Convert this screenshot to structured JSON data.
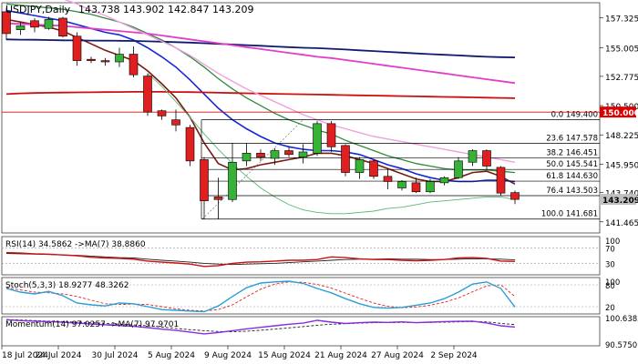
{
  "window": {
    "symbol_label": "USDJPY,Daily",
    "ohlc_label": "143.738 143.902 142.847 143.209"
  },
  "colors": {
    "background": "#ffffff",
    "bull": "#36b336",
    "bear": "#e02020",
    "ma_fast": "#7a1a10",
    "ma_blue": "#1428d8",
    "ma_green": "#2e8b3c",
    "ma_magenta": "#e040c8",
    "ma_red": "#cc1010",
    "ma_navy": "#101a6e",
    "ma_pink": "#f0a0e0",
    "bollinger": "#58b878",
    "fib_lines": "#000000",
    "last_price_box": "#c0c0c0",
    "level_150_box": "#dd0000",
    "rsi_line": "#cc1010",
    "rsi_ma": "#222222",
    "stoch_main": "#2a9fd6",
    "stoch_signal": "#dd2222",
    "momentum_main": "#8a2be2",
    "momentum_ma": "#222222"
  },
  "chart_data": {
    "type": "candlestick",
    "dates_axis": [
      "18 Jul 2024",
      "24 Jul 2024",
      "30 Jul 2024",
      "5 Aug 2024",
      "9 Aug 2024",
      "15 Aug 2024",
      "21 Aug 2024",
      "27 Aug 2024",
      "2 Sep 2024"
    ],
    "price_axis_ticks": [
      "157.325",
      "155.005",
      "152.775",
      "150.500",
      "148.225",
      "145.950",
      "143.740",
      "141.465"
    ],
    "y_range": [
      140.6,
      158.5
    ],
    "candles": [
      {
        "o": 157.8,
        "h": 158.1,
        "l": 155.6,
        "c": 156.1
      },
      {
        "o": 156.4,
        "h": 157.0,
        "l": 156.0,
        "c": 156.7
      },
      {
        "o": 157.1,
        "h": 157.3,
        "l": 156.2,
        "c": 156.6
      },
      {
        "o": 156.5,
        "h": 157.4,
        "l": 156.4,
        "c": 157.2
      },
      {
        "o": 157.3,
        "h": 157.4,
        "l": 155.8,
        "c": 155.9
      },
      {
        "o": 155.9,
        "h": 156.2,
        "l": 153.6,
        "c": 154.0
      },
      {
        "o": 154.1,
        "h": 154.3,
        "l": 153.8,
        "c": 154.0
      },
      {
        "o": 154.0,
        "h": 154.2,
        "l": 153.6,
        "c": 153.9
      },
      {
        "o": 153.9,
        "h": 155.0,
        "l": 153.5,
        "c": 154.5
      },
      {
        "o": 154.5,
        "h": 155.1,
        "l": 152.7,
        "c": 152.9
      },
      {
        "o": 152.8,
        "h": 153.0,
        "l": 149.7,
        "c": 150.0
      },
      {
        "o": 150.1,
        "h": 150.2,
        "l": 149.4,
        "c": 149.7
      },
      {
        "o": 149.4,
        "h": 150.2,
        "l": 148.5,
        "c": 149.0
      },
      {
        "o": 148.8,
        "h": 149.0,
        "l": 145.8,
        "c": 146.2
      },
      {
        "o": 146.3,
        "h": 146.5,
        "l": 141.7,
        "c": 143.1
      },
      {
        "o": 143.4,
        "h": 144.9,
        "l": 141.7,
        "c": 143.2
      },
      {
        "o": 143.2,
        "h": 147.6,
        "l": 143.0,
        "c": 146.1
      },
      {
        "o": 146.2,
        "h": 147.6,
        "l": 145.8,
        "c": 146.8
      },
      {
        "o": 146.8,
        "h": 147.1,
        "l": 146.2,
        "c": 146.5
      },
      {
        "o": 146.4,
        "h": 147.2,
        "l": 145.9,
        "c": 147.0
      },
      {
        "o": 147.0,
        "h": 147.3,
        "l": 146.5,
        "c": 146.7
      },
      {
        "o": 146.5,
        "h": 147.5,
        "l": 146.0,
        "c": 146.9
      },
      {
        "o": 146.8,
        "h": 149.3,
        "l": 146.6,
        "c": 149.1
      },
      {
        "o": 149.1,
        "h": 149.3,
        "l": 146.9,
        "c": 147.3
      },
      {
        "o": 147.4,
        "h": 147.5,
        "l": 145.0,
        "c": 145.3
      },
      {
        "o": 145.3,
        "h": 146.5,
        "l": 144.8,
        "c": 146.3
      },
      {
        "o": 146.2,
        "h": 146.3,
        "l": 144.8,
        "c": 145.0
      },
      {
        "o": 145.0,
        "h": 145.6,
        "l": 144.0,
        "c": 144.6
      },
      {
        "o": 144.1,
        "h": 144.7,
        "l": 143.9,
        "c": 144.6
      },
      {
        "o": 144.5,
        "h": 144.9,
        "l": 143.7,
        "c": 143.8
      },
      {
        "o": 143.8,
        "h": 144.8,
        "l": 143.7,
        "c": 144.6
      },
      {
        "o": 144.5,
        "h": 145.0,
        "l": 144.3,
        "c": 144.9
      },
      {
        "o": 144.9,
        "h": 146.5,
        "l": 144.8,
        "c": 146.2
      },
      {
        "o": 146.1,
        "h": 147.1,
        "l": 145.8,
        "c": 147.0
      },
      {
        "o": 147.0,
        "h": 147.1,
        "l": 145.5,
        "c": 145.8
      },
      {
        "o": 145.7,
        "h": 145.8,
        "l": 143.5,
        "c": 143.7
      },
      {
        "o": 143.738,
        "h": 143.902,
        "l": 142.847,
        "c": 143.209
      }
    ],
    "fibonacci_levels": [
      {
        "label": "0.0 149.400",
        "value": 149.4
      },
      {
        "label": "23.6 147.578",
        "value": 147.578
      },
      {
        "label": "38.2 146.451",
        "value": 146.451
      },
      {
        "label": "50.0 145.541",
        "value": 145.541
      },
      {
        "label": "61.8 144.630",
        "value": 144.63
      },
      {
        "label": "76.4 143.503",
        "value": 143.503
      },
      {
        "label": "100.0 141.681",
        "value": 141.681
      }
    ],
    "price_boxes": [
      {
        "label": "150.000",
        "value": 150.0
      },
      {
        "label": "143.209",
        "value": 143.209
      }
    ],
    "moving_averages": [
      {
        "key": "ma_fast",
        "values": [
          157.2,
          157.0,
          156.8,
          156.6,
          156.3,
          155.8,
          155.3,
          154.8,
          154.4,
          154.0,
          153.2,
          152.2,
          151.1,
          149.6,
          147.6,
          146.0,
          145.5,
          145.6,
          145.9,
          146.1,
          146.3,
          146.5,
          146.8,
          146.8,
          146.6,
          146.3,
          146.0,
          145.6,
          145.2,
          144.8,
          144.6,
          144.6,
          144.9,
          145.3,
          145.4,
          145.0,
          144.4
        ]
      },
      {
        "key": "ma_blue",
        "values": [
          157.9,
          157.7,
          157.5,
          157.3,
          157.1,
          156.8,
          156.5,
          156.2,
          156.0,
          155.6,
          155.0,
          154.3,
          153.5,
          152.5,
          151.4,
          150.3,
          149.4,
          148.7,
          148.1,
          147.6,
          147.3,
          147.1,
          147.0,
          147.0,
          146.9,
          146.7,
          146.3,
          145.9,
          145.6,
          145.2,
          144.9,
          144.7,
          144.6,
          144.6,
          144.7,
          144.7,
          144.6
        ]
      },
      {
        "key": "ma_green",
        "values": [
          158.4,
          158.3,
          158.2,
          158.1,
          158.0,
          157.8,
          157.6,
          157.3,
          157.0,
          156.6,
          156.1,
          155.6,
          155.0,
          154.3,
          153.5,
          152.6,
          151.8,
          151.1,
          150.5,
          149.9,
          149.4,
          149.0,
          148.6,
          148.3,
          147.8,
          147.4,
          147.0,
          146.6,
          146.3,
          146.0,
          145.8,
          145.6,
          145.5,
          145.5,
          145.5,
          145.4,
          145.3
        ]
      },
      {
        "key": "ma_navy",
        "values": [
          155.65,
          155.63,
          155.62,
          155.6,
          155.58,
          155.57,
          155.56,
          155.55,
          155.54,
          155.53,
          155.5,
          155.47,
          155.44,
          155.4,
          155.35,
          155.3,
          155.25,
          155.2,
          155.15,
          155.1,
          155.05,
          155.0,
          154.97,
          154.92,
          154.86,
          154.8,
          154.74,
          154.68,
          154.62,
          154.56,
          154.5,
          154.45,
          154.4,
          154.35,
          154.3,
          154.27,
          154.25
        ]
      },
      {
        "key": "ma_magenta",
        "values": [
          156.9,
          156.85,
          156.8,
          156.75,
          156.7,
          156.6,
          156.5,
          156.4,
          156.3,
          156.2,
          156.1,
          155.95,
          155.8,
          155.65,
          155.5,
          155.35,
          155.2,
          155.05,
          154.9,
          154.75,
          154.6,
          154.45,
          154.3,
          154.2,
          154.05,
          153.9,
          153.75,
          153.6,
          153.45,
          153.3,
          153.15,
          153.0,
          152.85,
          152.7,
          152.55,
          152.4,
          152.25
        ]
      },
      {
        "key": "ma_red",
        "values": [
          151.4,
          151.45,
          151.48,
          151.5,
          151.52,
          151.53,
          151.54,
          151.55,
          151.56,
          151.57,
          151.57,
          151.57,
          151.56,
          151.55,
          151.53,
          151.5,
          151.48,
          151.46,
          151.44,
          151.42,
          151.4,
          151.38,
          151.36,
          151.34,
          151.32,
          151.3,
          151.28,
          151.26,
          151.24,
          151.22,
          151.2,
          151.18,
          151.16,
          151.14,
          151.12,
          151.1,
          151.08
        ]
      },
      {
        "key": "ma_pink",
        "values": [
          160.0,
          159.8,
          159.5,
          159.2,
          158.8,
          158.4,
          157.9,
          157.5,
          157.0,
          156.5,
          156.0,
          155.5,
          155.0,
          154.4,
          153.7,
          153.0,
          152.4,
          151.8,
          151.3,
          150.8,
          150.3,
          149.8,
          149.4,
          149.0,
          148.7,
          148.4,
          148.1,
          147.9,
          147.7,
          147.5,
          147.3,
          147.1,
          146.9,
          146.7,
          146.5,
          146.3,
          146.1
        ]
      },
      {
        "key": "bollinger",
        "values": [
          null,
          null,
          null,
          null,
          null,
          null,
          null,
          null,
          null,
          null,
          153.0,
          152.0,
          150.8,
          149.6,
          148.3,
          147.1,
          146.0,
          145.0,
          144.1,
          143.4,
          142.8,
          142.4,
          142.2,
          142.1,
          142.1,
          142.2,
          142.3,
          142.5,
          142.6,
          142.8,
          143.0,
          143.1,
          143.2,
          143.3,
          143.4,
          143.4,
          143.2
        ]
      }
    ],
    "subpanels": [
      {
        "key": "rsi",
        "label": "RSI(14) 34.5862   ->MA(7) 38.8860",
        "ticks": [
          "70",
          "30"
        ],
        "extra_ticks": [
          "100"
        ],
        "range": [
          0,
          100
        ],
        "levels": [
          70,
          30
        ],
        "main": [
          58,
          57,
          55,
          54,
          52,
          50,
          46,
          44,
          43,
          41,
          36,
          33,
          31,
          28,
          22,
          24,
          30,
          33,
          34,
          36,
          38,
          38,
          40,
          47,
          45,
          42,
          40,
          40,
          38,
          37,
          38,
          40,
          44,
          45,
          43,
          36,
          35
        ],
        "signal": [
          56,
          55,
          54,
          53,
          52,
          51,
          49,
          47,
          45,
          44,
          41,
          38,
          36,
          33,
          30,
          28,
          27,
          28,
          29,
          30,
          32,
          34,
          36,
          38,
          40,
          41,
          41,
          42,
          41,
          41,
          40,
          40,
          41,
          42,
          42,
          41,
          39
        ]
      },
      {
        "key": "stoch",
        "label": "Stoch(5,3,3) 18.9277 48.3262",
        "ticks": [
          "80",
          "20"
        ],
        "extra_ticks": [
          "100"
        ],
        "range": [
          0,
          100
        ],
        "levels": [
          80,
          20
        ],
        "main": [
          70,
          60,
          55,
          62,
          50,
          30,
          25,
          22,
          30,
          28,
          20,
          12,
          10,
          8,
          6,
          22,
          48,
          72,
          85,
          88,
          90,
          84,
          70,
          58,
          42,
          28,
          18,
          16,
          18,
          24,
          30,
          42,
          60,
          82,
          88,
          70,
          19
        ],
        "signal": [
          72,
          66,
          60,
          58,
          55,
          48,
          38,
          28,
          26,
          27,
          26,
          20,
          14,
          10,
          8,
          12,
          25,
          47,
          68,
          82,
          88,
          87,
          81,
          71,
          57,
          43,
          30,
          21,
          17,
          19,
          24,
          32,
          44,
          61,
          77,
          80,
          48
        ]
      },
      {
        "key": "momentum",
        "label": "Momentum(14) 97.0257   ->MA(7) 97.9701",
        "ticks": [
          "100.6385",
          "90.5750"
        ],
        "range": [
          89.8,
          101.0
        ],
        "levels": [],
        "main": [
          99.8,
          99.5,
          99.3,
          99.1,
          98.9,
          98.5,
          98.2,
          97.9,
          97.6,
          97.3,
          96.8,
          96.2,
          95.7,
          95.1,
          94.4,
          94.9,
          95.6,
          96.3,
          96.9,
          97.5,
          98.1,
          98.5,
          99.6,
          98.9,
          98.4,
          98.7,
          98.9,
          98.8,
          99.0,
          98.7,
          98.9,
          99.1,
          99.2,
          99.3,
          98.6,
          97.5,
          97.0
        ],
        "signal": [
          99.9,
          99.7,
          99.5,
          99.3,
          99.1,
          98.9,
          98.7,
          98.4,
          98.1,
          97.8,
          97.5,
          97.0,
          96.5,
          96.0,
          95.6,
          95.3,
          95.2,
          95.4,
          95.8,
          96.2,
          96.7,
          97.2,
          97.7,
          98.1,
          98.3,
          98.5,
          98.7,
          98.7,
          98.8,
          98.7,
          98.8,
          98.9,
          99.0,
          99.1,
          99.0,
          98.4,
          97.97
        ]
      }
    ]
  }
}
